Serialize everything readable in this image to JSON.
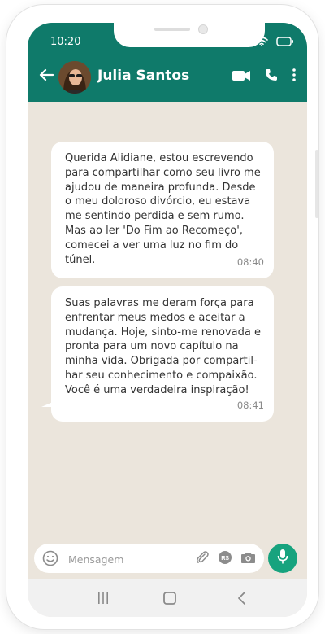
{
  "status_bar": {
    "time": "10:20"
  },
  "header": {
    "contact_name": "Julia Santos",
    "icons": [
      "back-arrow-icon",
      "video-call-icon",
      "phone-call-icon",
      "more-options-icon"
    ]
  },
  "messages": [
    {
      "text": "Querida Alidiane, estou escrevendo para compartilhar como seu livro me ajudou de maneira profunda. Desde o meu doloroso divórcio, eu estava me sentindo perdida e sem rumo. Mas ao ler 'Do Fim ao Recomeço', comecei a ver uma luz no fim do túnel.",
      "time": "08:40"
    },
    {
      "text": "Suas palavras me deram força para enfrentar meus medos e aceitar a mudança. Hoje, sinto-me renovada e pronta para um novo capítulo na minha vida. Obrigada por compartil-har seu conhecimento e compaixão. Você é uma verdadeira inspiração!",
      "time": "08:41"
    }
  ],
  "composer": {
    "placeholder": "Mensagem",
    "value": "",
    "icons": [
      "emoji-icon",
      "attach-icon",
      "payment-icon",
      "camera-icon",
      "mic-icon"
    ]
  },
  "colors": {
    "header": "#0f7a6a",
    "chat_background": "#ebe5dc",
    "bubble": "#ffffff",
    "mic_button": "#17a37e"
  }
}
